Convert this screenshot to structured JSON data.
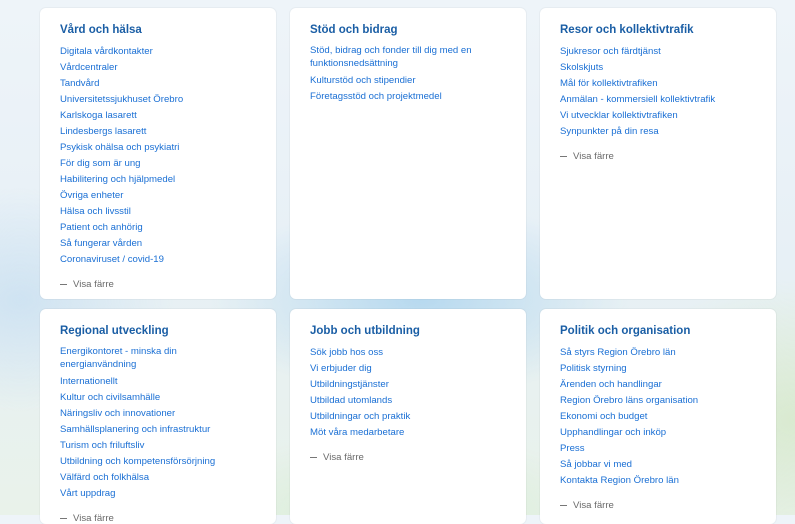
{
  "show_less_label": "Visa färre",
  "cards": [
    {
      "title": "Vård och hälsa",
      "links": [
        "Digitala vårdkontakter",
        "Vårdcentraler",
        "Tandvård",
        "Universitetssjukhuset Örebro",
        "Karlskoga lasarett",
        "Lindesbergs lasarett",
        "Psykisk ohälsa och psykiatri",
        "För dig som är ung",
        "Habilitering och hjälpmedel",
        "Övriga enheter",
        "Hälsa och livsstil",
        "Patient och anhörig",
        "Så fungerar vården",
        "Coronaviruset / covid-19"
      ]
    },
    {
      "title": "Stöd och bidrag",
      "links": [
        "Stöd, bidrag och fonder till dig med en funktionsnedsättning",
        "Kulturstöd och stipendier",
        "Företagsstöd och projektmedel"
      ]
    },
    {
      "title": "Resor och kollektivtrafik",
      "links": [
        "Sjukresor och färdtjänst",
        "Skolskjuts",
        "Mål för kollektivtrafiken",
        "Anmälan - kommersiell kollektivtrafik",
        "Vi utvecklar kollektivtrafiken",
        "Synpunkter på din resa"
      ]
    },
    {
      "title": "Regional utveckling",
      "links": [
        "Energikontoret - minska din energianvändning",
        "Internationellt",
        "Kultur och civilsamhälle",
        "Näringsliv och innovationer",
        "Samhällsplanering och infrastruktur",
        "Turism och friluftsliv",
        "Utbildning och kompetensförsörjning",
        "Välfärd och folkhälsa",
        "Vårt uppdrag"
      ]
    },
    {
      "title": "Jobb och utbildning",
      "links": [
        "Sök jobb hos oss",
        "Vi erbjuder dig",
        "Utbildningstjänster",
        "Utbildad utomlands",
        "Utbildningar och praktik",
        "Möt våra medarbetare"
      ]
    },
    {
      "title": "Politik och organisation",
      "links": [
        "Så styrs Region Örebro län",
        "Politisk styrning",
        "Ärenden och handlingar",
        "Region Örebro läns organisation",
        "Ekonomi och budget",
        "Upphandlingar och inköp",
        "Press",
        "Så jobbar vi med",
        "Kontakta Region Örebro län"
      ]
    }
  ]
}
